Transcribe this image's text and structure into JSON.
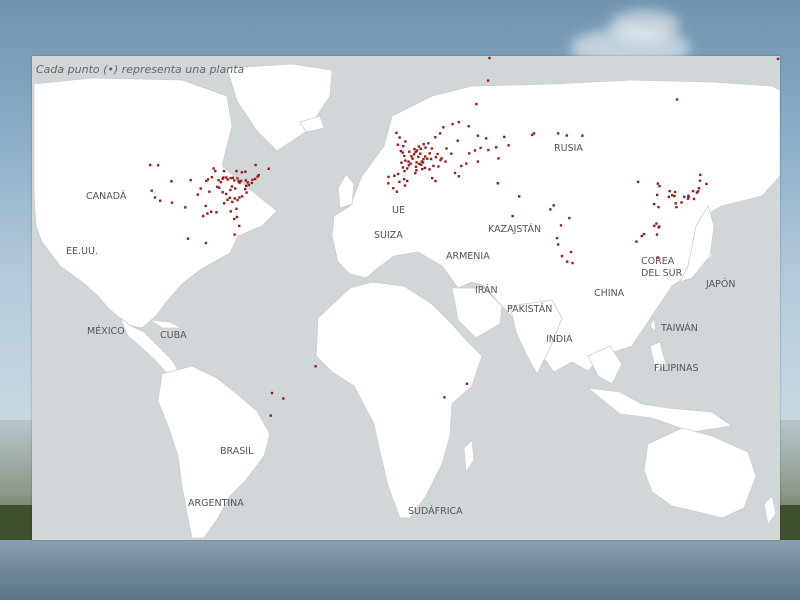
{
  "caption": "Cada punto (•) representa una planta",
  "colors": {
    "ocean": "#d1d6d9",
    "land": "#ffffff",
    "border": "#c8cdd1",
    "dot": "#a01818"
  },
  "labels": {
    "rusia": "RUSIA",
    "canada": "CANADÁ",
    "ue": "UE",
    "suiza": "SUIZA",
    "kazajstan": "KAZAJSTÁN",
    "eeuu": "EE.UU.",
    "armenia": "ARMENIA",
    "corea": "COREA DEL SUR",
    "japon": "JAPÓN",
    "iran": "IRÁN",
    "china": "CHINA",
    "pakistan": "PAKISTÁN",
    "mexico": "MÉXICO",
    "cuba": "CUBA",
    "india": "INDIA",
    "taiwan": "TAIWÁN",
    "filipinas": "FILIPINAS",
    "brasil": "BRASIL",
    "argentina": "ARGENTINA",
    "sudafrica": "SUDÁFRICA"
  },
  "plant_dots": [
    {
      "lon": -122.4,
      "lat": 37.6
    },
    {
      "lon": -120.8,
      "lat": 35.2
    },
    {
      "lon": -118.3,
      "lat": 34.1
    },
    {
      "lon": -112.6,
      "lat": 33.4
    },
    {
      "lon": -106.2,
      "lat": 31.8
    },
    {
      "lon": -97.6,
      "lat": 28.8
    },
    {
      "lon": -96.4,
      "lat": 32.3
    },
    {
      "lon": -95.6,
      "lat": 29.7
    },
    {
      "lon": -93.8,
      "lat": 30.3
    },
    {
      "lon": -91.2,
      "lat": 30.1
    },
    {
      "lon": -94.6,
      "lat": 37.2
    },
    {
      "lon": -96.1,
      "lat": 40.9
    },
    {
      "lon": -95.3,
      "lat": 41.4
    },
    {
      "lon": -93.4,
      "lat": 42.2
    },
    {
      "lon": -91.8,
      "lat": 44.3
    },
    {
      "lon": -92.6,
      "lat": 45.2
    },
    {
      "lon": -90.2,
      "lat": 41.2
    },
    {
      "lon": -89.1,
      "lat": 40.5
    },
    {
      "lon": -88.2,
      "lat": 41.7
    },
    {
      "lon": -87.9,
      "lat": 42.1
    },
    {
      "lon": -87.6,
      "lat": 44.3
    },
    {
      "lon": -86.5,
      "lat": 42.1
    },
    {
      "lon": -85.8,
      "lat": 41.4
    },
    {
      "lon": -84.4,
      "lat": 41.9
    },
    {
      "lon": -83.3,
      "lat": 42.0
    },
    {
      "lon": -82.6,
      "lat": 41.1
    },
    {
      "lon": -81.1,
      "lat": 41.8
    },
    {
      "lon": -80.6,
      "lat": 40.8
    },
    {
      "lon": -80.1,
      "lat": 40.3
    },
    {
      "lon": -79.4,
      "lat": 40.9
    },
    {
      "lon": -77.1,
      "lat": 41.1
    },
    {
      "lon": -76.2,
      "lat": 40.4
    },
    {
      "lon": -75.6,
      "lat": 39.5
    },
    {
      "lon": -74.2,
      "lat": 40.2
    },
    {
      "lon": -73.9,
      "lat": 41.3
    },
    {
      "lon": -72.6,
      "lat": 41.6
    },
    {
      "lon": -71.4,
      "lat": 42.4
    },
    {
      "lon": -70.9,
      "lat": 42.9
    },
    {
      "lon": -76.9,
      "lat": 39.2
    },
    {
      "lon": -77.4,
      "lat": 38.1
    },
    {
      "lon": -76.7,
      "lat": 36.9
    },
    {
      "lon": -78.9,
      "lat": 35.6
    },
    {
      "lon": -80.2,
      "lat": 35.2
    },
    {
      "lon": -81.1,
      "lat": 34.3
    },
    {
      "lon": -82.4,
      "lat": 34.9
    },
    {
      "lon": -83.6,
      "lat": 33.7
    },
    {
      "lon": -84.8,
      "lat": 35.1
    },
    {
      "lon": -85.9,
      "lat": 34.4
    },
    {
      "lon": -86.6,
      "lat": 36.4
    },
    {
      "lon": -87.5,
      "lat": 33.2
    },
    {
      "lon": -88.2,
      "lat": 37.0
    },
    {
      "lon": -89.9,
      "lat": 38.6
    },
    {
      "lon": -90.8,
      "lat": 38.9
    },
    {
      "lon": -83.8,
      "lat": 39.0
    },
    {
      "lon": -84.5,
      "lat": 37.8
    },
    {
      "lon": -82.2,
      "lat": 38.3
    },
    {
      "lon": -81.4,
      "lat": 28.5
    },
    {
      "lon": -80.3,
      "lat": 25.4
    },
    {
      "lon": -82.7,
      "lat": 27.8
    },
    {
      "lon": -84.3,
      "lat": 30.4
    },
    {
      "lon": -81.6,
      "lat": 31.3
    },
    {
      "lon": -98.8,
      "lat": 38.3
    },
    {
      "lon": -100.2,
      "lat": 36.2
    },
    {
      "lon": -103.6,
      "lat": 41.2
    },
    {
      "lon": -123.1,
      "lat": 46.4
    },
    {
      "lon": -119.3,
      "lat": 46.3
    },
    {
      "lon": -112.9,
      "lat": 40.8
    },
    {
      "lon": -104.9,
      "lat": 21.0
    },
    {
      "lon": -96.3,
      "lat": 19.5
    },
    {
      "lon": -77.3,
      "lat": 44.1
    },
    {
      "lon": -81.6,
      "lat": 44.3
    },
    {
      "lon": -79.0,
      "lat": 43.9
    },
    {
      "lon": -72.4,
      "lat": 46.4
    },
    {
      "lon": -66.1,
      "lat": 45.1
    },
    {
      "lon": -82.5,
      "lat": 22.4
    },
    {
      "lon": -43.5,
      "lat": -23.0
    },
    {
      "lon": -59.0,
      "lat": -34.1
    },
    {
      "lon": -64.5,
      "lat": -32.2
    },
    {
      "lon": -65.1,
      "lat": -40.0
    },
    {
      "lon": -3.9,
      "lat": 53.4
    },
    {
      "lon": -2.5,
      "lat": 51.2
    },
    {
      "lon": -1.3,
      "lat": 52.9
    },
    {
      "lon": -0.3,
      "lat": 54.5
    },
    {
      "lon": -3.1,
      "lat": 55.9
    },
    {
      "lon": -4.6,
      "lat": 57.5
    },
    {
      "lon": 1.6,
      "lat": 51.0
    },
    {
      "lon": -1.6,
      "lat": 50.7
    },
    {
      "lon": -0.8,
      "lat": 49.5
    },
    {
      "lon": 1.2,
      "lat": 47.6
    },
    {
      "lon": 2.6,
      "lat": 49.4
    },
    {
      "lon": 3.9,
      "lat": 50.1
    },
    {
      "lon": 4.6,
      "lat": 50.9
    },
    {
      "lon": 5.3,
      "lat": 51.4
    },
    {
      "lon": 4.1,
      "lat": 51.9
    },
    {
      "lon": 6.2,
      "lat": 52.8
    },
    {
      "lon": 7.1,
      "lat": 52.0
    },
    {
      "lon": 8.5,
      "lat": 53.6
    },
    {
      "lon": 9.4,
      "lat": 52.4
    },
    {
      "lon": 10.8,
      "lat": 53.9
    },
    {
      "lon": 12.4,
      "lat": 52.1
    },
    {
      "lon": 11.4,
      "lat": 50.4
    },
    {
      "lon": 9.2,
      "lat": 49.3
    },
    {
      "lon": 8.4,
      "lat": 48.4
    },
    {
      "lon": 10.2,
      "lat": 48.6
    },
    {
      "lon": 12.1,
      "lat": 48.5
    },
    {
      "lon": 7.6,
      "lat": 47.6
    },
    {
      "lon": 8.2,
      "lat": 47.3
    },
    {
      "lon": 7.3,
      "lat": 46.5
    },
    {
      "lon": 6.4,
      "lat": 46.8
    },
    {
      "lon": 5.1,
      "lat": 47.3
    },
    {
      "lon": 4.8,
      "lat": 45.8
    },
    {
      "lon": 5.0,
      "lat": 44.6
    },
    {
      "lon": 4.5,
      "lat": 43.6
    },
    {
      "lon": 2.2,
      "lat": 46.9
    },
    {
      "lon": 1.4,
      "lat": 46.3
    },
    {
      "lon": 0.6,
      "lat": 45.2
    },
    {
      "lon": -0.7,
      "lat": 44.3
    },
    {
      "lon": -1.5,
      "lat": 45.6
    },
    {
      "lon": -2.2,
      "lat": 47.2
    },
    {
      "lon": -0.3,
      "lat": 47.9
    },
    {
      "lon": 3.2,
      "lat": 48.6
    },
    {
      "lon": 5.9,
      "lat": 49.2
    },
    {
      "lon": 6.9,
      "lat": 50.3
    },
    {
      "lon": -3.8,
      "lat": 43.3
    },
    {
      "lon": -5.6,
      "lat": 42.7
    },
    {
      "lon": -8.4,
      "lat": 42.3
    },
    {
      "lon": -3.2,
      "lat": 40.6
    },
    {
      "lon": -0.9,
      "lat": 41.5
    },
    {
      "lon": 0.6,
      "lat": 40.9
    },
    {
      "lon": -0.5,
      "lat": 39.3
    },
    {
      "lon": -4.4,
      "lat": 37.2
    },
    {
      "lon": -6.1,
      "lat": 38.4
    },
    {
      "lon": -8.5,
      "lat": 40.1
    },
    {
      "lon": 9.1,
      "lat": 45.4
    },
    {
      "lon": 11.3,
      "lat": 44.9
    },
    {
      "lon": 12.6,
      "lat": 41.9
    },
    {
      "lon": 14.2,
      "lat": 40.9
    },
    {
      "lon": 7.8,
      "lat": 45.0
    },
    {
      "lon": 15.2,
      "lat": 50.2
    },
    {
      "lon": 14.4,
      "lat": 49.1
    },
    {
      "lon": 16.6,
      "lat": 48.1
    },
    {
      "lon": 19.0,
      "lat": 47.6
    },
    {
      "lon": 17.1,
      "lat": 48.7
    },
    {
      "lon": 15.6,
      "lat": 45.9
    },
    {
      "lon": 13.2,
      "lat": 46.1
    },
    {
      "lon": 18.0,
      "lat": 59.4
    },
    {
      "lon": 16.4,
      "lat": 57.3
    },
    {
      "lon": 14.1,
      "lat": 56.0
    },
    {
      "lon": 22.4,
      "lat": 60.5
    },
    {
      "lon": 25.4,
      "lat": 61.2
    },
    {
      "lon": 24.9,
      "lat": 54.8
    },
    {
      "lon": 19.5,
      "lat": 52.1
    },
    {
      "lon": 21.8,
      "lat": 50.3
    },
    {
      "lon": 26.6,
      "lat": 46.1
    },
    {
      "lon": 23.6,
      "lat": 43.7
    },
    {
      "lon": 25.4,
      "lat": 42.5
    },
    {
      "lon": 30.4,
      "lat": 50.4
    },
    {
      "lon": 34.6,
      "lat": 47.6
    },
    {
      "lon": 33.2,
      "lat": 51.4
    },
    {
      "lon": 29.0,
      "lat": 46.9
    },
    {
      "lon": 30.2,
      "lat": 59.8
    },
    {
      "lon": 33.9,
      "lat": 67.4
    },
    {
      "lon": 34.6,
      "lat": 56.5
    },
    {
      "lon": 35.9,
      "lat": 52.3
    },
    {
      "lon": 38.6,
      "lat": 55.6
    },
    {
      "lon": 39.6,
      "lat": 51.6
    },
    {
      "lon": 43.4,
      "lat": 52.5
    },
    {
      "lon": 44.5,
      "lat": 48.7
    },
    {
      "lon": 47.3,
      "lat": 56.1
    },
    {
      "lon": 49.4,
      "lat": 53.2
    },
    {
      "lon": 44.2,
      "lat": 40.1
    },
    {
      "lon": 60.7,
      "lat": 56.8
    },
    {
      "lon": 61.6,
      "lat": 57.3
    },
    {
      "lon": 73.2,
      "lat": 57.3
    },
    {
      "lon": 77.4,
      "lat": 56.6
    },
    {
      "lon": 84.9,
      "lat": 56.5
    },
    {
      "lon": 54.5,
      "lat": 35.6
    },
    {
      "lon": 51.3,
      "lat": 28.8
    },
    {
      "lon": 40.2,
      "lat": 83.5
    },
    {
      "lon": 71.1,
      "lat": 32.5
    },
    {
      "lon": 69.5,
      "lat": 31.1
    },
    {
      "lon": 72.7,
      "lat": 21.2
    },
    {
      "lon": 73.2,
      "lat": 19.0
    },
    {
      "lon": 74.6,
      "lat": 25.6
    },
    {
      "lon": 78.6,
      "lat": 28.1
    },
    {
      "lon": 79.4,
      "lat": 16.4
    },
    {
      "lon": 80.2,
      "lat": 12.6
    },
    {
      "lon": 77.6,
      "lat": 13.1
    },
    {
      "lon": 75.1,
      "lat": 15.0
    },
    {
      "lon": 111.7,
      "lat": 40.6
    },
    {
      "lon": 110.9,
      "lat": 20.0
    },
    {
      "lon": 113.5,
      "lat": 21.9
    },
    {
      "lon": 114.5,
      "lat": 22.6
    },
    {
      "lon": 119.5,
      "lat": 25.4
    },
    {
      "lon": 120.5,
      "lat": 26.2
    },
    {
      "lon": 121.5,
      "lat": 31.9
    },
    {
      "lon": 120.9,
      "lat": 36.1
    },
    {
      "lon": 121.2,
      "lat": 40.0
    },
    {
      "lon": 122.0,
      "lat": 39.1
    },
    {
      "lon": 119.4,
      "lat": 32.9
    },
    {
      "lon": 121.6,
      "lat": 24.9
    },
    {
      "lon": 121.9,
      "lat": 25.2
    },
    {
      "lon": 120.8,
      "lat": 22.4
    },
    {
      "lon": 121.2,
      "lat": 14.5
    },
    {
      "lon": 126.5,
      "lat": 35.4
    },
    {
      "lon": 129.2,
      "lat": 35.7
    },
    {
      "lon": 129.5,
      "lat": 37.1
    },
    {
      "lon": 128.1,
      "lat": 36.0
    },
    {
      "lon": 126.9,
      "lat": 37.4
    },
    {
      "lon": 129.8,
      "lat": 33.2
    },
    {
      "lon": 130.2,
      "lat": 31.9
    },
    {
      "lon": 132.6,
      "lat": 33.5
    },
    {
      "lon": 133.9,
      "lat": 35.4
    },
    {
      "lon": 135.9,
      "lat": 35.8
    },
    {
      "lon": 136.0,
      "lat": 35.4
    },
    {
      "lon": 135.7,
      "lat": 34.8
    },
    {
      "lon": 138.6,
      "lat": 34.7
    },
    {
      "lon": 138.2,
      "lat": 37.4
    },
    {
      "lon": 140.0,
      "lat": 36.9
    },
    {
      "lon": 140.6,
      "lat": 37.3
    },
    {
      "lon": 141.0,
      "lat": 38.4
    },
    {
      "lon": 141.5,
      "lat": 41.0
    },
    {
      "lon": 141.6,
      "lat": 43.0
    },
    {
      "lon": 180.0,
      "lat": 83.0
    },
    {
      "lon": 130.5,
      "lat": 69.0
    },
    {
      "lon": 39.5,
      "lat": 75.5
    },
    {
      "lon": 29.3,
      "lat": -29.0
    },
    {
      "lon": 18.5,
      "lat": -33.7
    },
    {
      "lon": 144.6,
      "lat": 39.9
    }
  ]
}
